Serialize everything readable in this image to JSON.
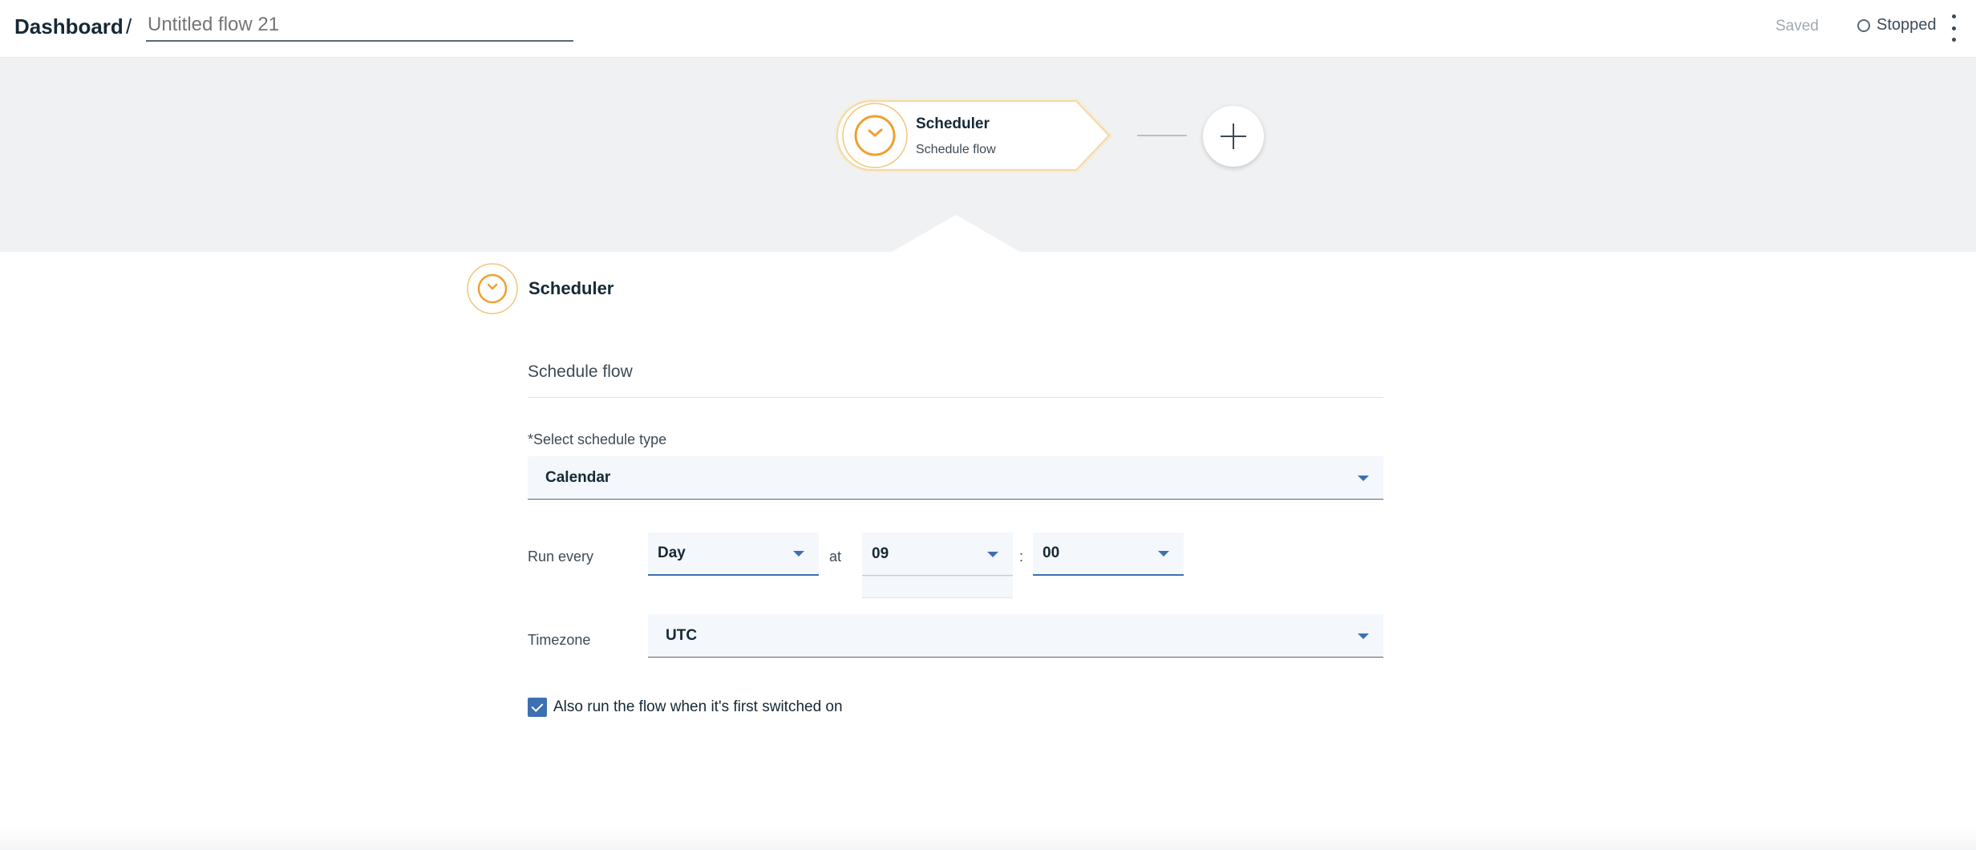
{
  "header": {
    "breadcrumb_root": "Dashboard",
    "breadcrumb_separator": "/",
    "flow_name_placeholder": "Untitled flow 21",
    "save_state": "Saved",
    "run_status": "Stopped"
  },
  "canvas": {
    "node": {
      "title": "Scheduler",
      "subtitle": "Schedule flow",
      "icon": "clock-icon"
    },
    "add_icon": "plus-icon"
  },
  "panel": {
    "title": "Scheduler",
    "icon": "clock-icon",
    "description": "Schedule flow",
    "schedule_type": {
      "label": "*Select schedule type",
      "value": "Calendar"
    },
    "run_every": {
      "label": "Run every",
      "unit": "Day",
      "at_label": "at",
      "hour": "09",
      "separator": ":",
      "minute": "00"
    },
    "timezone": {
      "label": "Timezone",
      "value": "UTC"
    },
    "run_on_switch": {
      "checked": true,
      "label": "Also run the flow when it's first switched on"
    }
  },
  "colors": {
    "accent": "#3d70b2",
    "icon_orange": "#f0a030",
    "text_primary": "#152935",
    "canvas_bg": "#f0f1f2",
    "field_bg": "#f4f7fb"
  }
}
